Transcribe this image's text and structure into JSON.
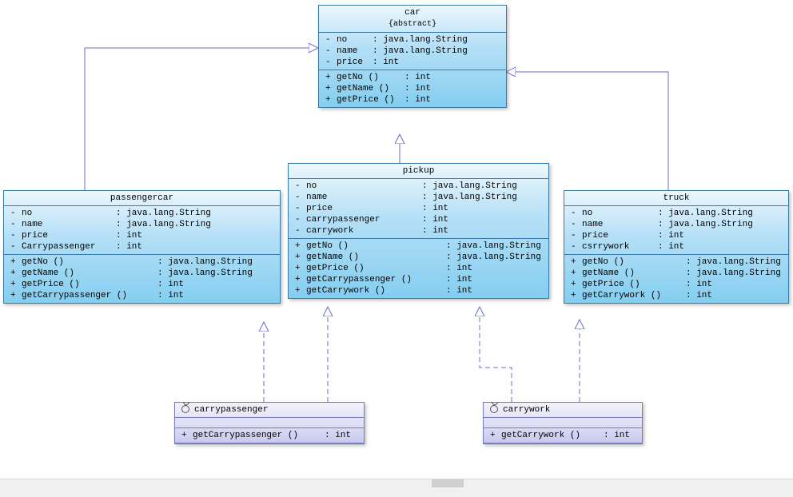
{
  "classes": {
    "car": {
      "name": "car",
      "stereotype": "{abstract}",
      "attributes": [
        {
          "vis": "-",
          "name": "no",
          "type": "java.lang.String"
        },
        {
          "vis": "-",
          "name": "name",
          "type": "java.lang.String"
        },
        {
          "vis": "-",
          "name": "price",
          "type": "int"
        }
      ],
      "methods": [
        {
          "vis": "+",
          "name": "getNo ()",
          "ret": "int"
        },
        {
          "vis": "+",
          "name": "getName ()",
          "ret": "int"
        },
        {
          "vis": "+",
          "name": "getPrice ()",
          "ret": "int"
        }
      ]
    },
    "passengercar": {
      "name": "passengercar",
      "attributes": [
        {
          "vis": "-",
          "name": "no",
          "type": "java.lang.String"
        },
        {
          "vis": "-",
          "name": "name",
          "type": "java.lang.String"
        },
        {
          "vis": "-",
          "name": "price",
          "type": "int"
        },
        {
          "vis": "-",
          "name": "Carrypassenger",
          "type": "int"
        }
      ],
      "methods": [
        {
          "vis": "+",
          "name": "getNo ()",
          "ret": "java.lang.String"
        },
        {
          "vis": "+",
          "name": "getName ()",
          "ret": "java.lang.String"
        },
        {
          "vis": "+",
          "name": "getPrice ()",
          "ret": "int"
        },
        {
          "vis": "+",
          "name": "getCarrypassenger ()",
          "ret": "int"
        }
      ]
    },
    "pickup": {
      "name": "pickup",
      "attributes": [
        {
          "vis": "-",
          "name": "no",
          "type": "java.lang.String"
        },
        {
          "vis": "-",
          "name": "name",
          "type": "java.lang.String"
        },
        {
          "vis": "-",
          "name": "price",
          "type": "int"
        },
        {
          "vis": "-",
          "name": "carrypassenger",
          "type": "int"
        },
        {
          "vis": "-",
          "name": "carrywork",
          "type": "int"
        }
      ],
      "methods": [
        {
          "vis": "+",
          "name": "getNo ()",
          "ret": "java.lang.String"
        },
        {
          "vis": "+",
          "name": "getName ()",
          "ret": "java.lang.String"
        },
        {
          "vis": "+",
          "name": "getPrice ()",
          "ret": "int"
        },
        {
          "vis": "+",
          "name": "getCarrypassenger ()",
          "ret": "int"
        },
        {
          "vis": "+",
          "name": "getCarrywork ()",
          "ret": "int"
        }
      ]
    },
    "truck": {
      "name": "truck",
      "attributes": [
        {
          "vis": "-",
          "name": "no",
          "type": "java.lang.String"
        },
        {
          "vis": "-",
          "name": "name",
          "type": "java.lang.String"
        },
        {
          "vis": "-",
          "name": "price",
          "type": "int"
        },
        {
          "vis": "-",
          "name": "csrrywork",
          "type": "int"
        }
      ],
      "methods": [
        {
          "vis": "+",
          "name": "getNo ()",
          "ret": "java.lang.String"
        },
        {
          "vis": "+",
          "name": "getName ()",
          "ret": "java.lang.String"
        },
        {
          "vis": "+",
          "name": "getPrice ()",
          "ret": "int"
        },
        {
          "vis": "+",
          "name": "getCarrywork ()",
          "ret": "int"
        }
      ]
    },
    "carrypassenger": {
      "name": "carrypassenger",
      "methods": [
        {
          "vis": "+",
          "name": "getCarrypassenger ()",
          "ret": "int"
        }
      ]
    },
    "carrywork": {
      "name": "carrywork",
      "methods": [
        {
          "vis": "+",
          "name": "getCarrywork ()",
          "ret": "int"
        }
      ]
    }
  },
  "chart_data": {
    "type": "uml-class-diagram",
    "classes": [
      {
        "id": "car",
        "abstract": true,
        "attributes": [
          "-no:java.lang.String",
          "-name:java.lang.String",
          "-price:int"
        ],
        "methods": [
          "+getNo():int",
          "+getName():int",
          "+getPrice():int"
        ]
      },
      {
        "id": "passengercar",
        "attributes": [
          "-no:java.lang.String",
          "-name:java.lang.String",
          "-price:int",
          "-Carrypassenger:int"
        ],
        "methods": [
          "+getNo():java.lang.String",
          "+getName():java.lang.String",
          "+getPrice():int",
          "+getCarrypassenger():int"
        ]
      },
      {
        "id": "pickup",
        "attributes": [
          "-no:java.lang.String",
          "-name:java.lang.String",
          "-price:int",
          "-carrypassenger:int",
          "-carrywork:int"
        ],
        "methods": [
          "+getNo():java.lang.String",
          "+getName():java.lang.String",
          "+getPrice():int",
          "+getCarrypassenger():int",
          "+getCarrywork():int"
        ]
      },
      {
        "id": "truck",
        "attributes": [
          "-no:java.lang.String",
          "-name:java.lang.String",
          "-price:int",
          "-csrrywork:int"
        ],
        "methods": [
          "+getNo():java.lang.String",
          "+getName():java.lang.String",
          "+getPrice():int",
          "+getCarrywork():int"
        ]
      },
      {
        "id": "carrypassenger",
        "interface": true,
        "methods": [
          "+getCarrypassenger():int"
        ]
      },
      {
        "id": "carrywork",
        "interface": true,
        "methods": [
          "+getCarrywork():int"
        ]
      }
    ],
    "relations": [
      {
        "from": "passengercar",
        "to": "car",
        "type": "generalization"
      },
      {
        "from": "pickup",
        "to": "car",
        "type": "generalization"
      },
      {
        "from": "truck",
        "to": "car",
        "type": "generalization"
      },
      {
        "from": "passengercar",
        "to": "carrypassenger",
        "type": "realization"
      },
      {
        "from": "pickup",
        "to": "carrypassenger",
        "type": "realization"
      },
      {
        "from": "pickup",
        "to": "carrywork",
        "type": "realization"
      },
      {
        "from": "truck",
        "to": "carrywork",
        "type": "realization"
      }
    ]
  }
}
